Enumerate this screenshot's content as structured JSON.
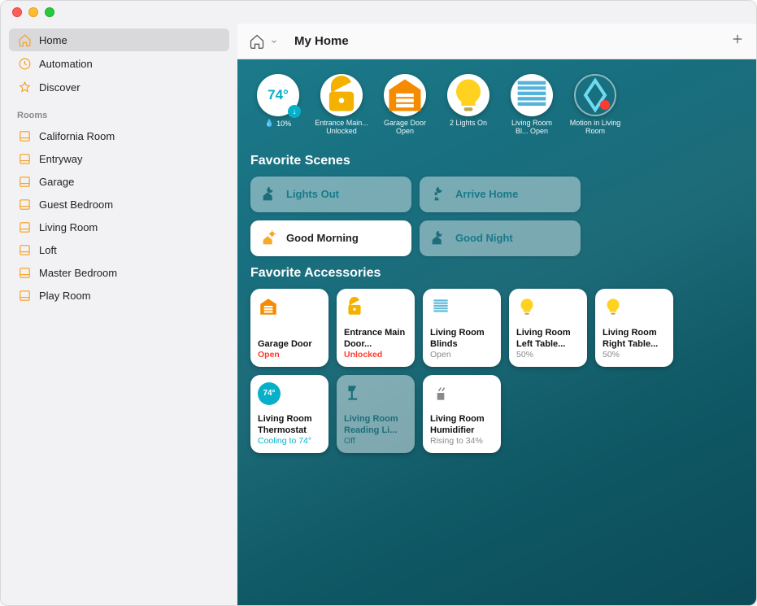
{
  "header": {
    "title": "My Home"
  },
  "sidebar": {
    "primary": [
      {
        "label": "Home",
        "icon": "home"
      },
      {
        "label": "Automation",
        "icon": "clock"
      },
      {
        "label": "Discover",
        "icon": "star"
      }
    ],
    "rooms_heading": "Rooms",
    "rooms": [
      {
        "label": "California Room"
      },
      {
        "label": "Entryway"
      },
      {
        "label": "Garage"
      },
      {
        "label": "Guest Bedroom"
      },
      {
        "label": "Living Room"
      },
      {
        "label": "Loft"
      },
      {
        "label": "Master Bedroom"
      },
      {
        "label": "Play Room"
      }
    ]
  },
  "status": {
    "temp": {
      "value": "74°",
      "precip": "10%"
    },
    "chips": [
      {
        "label": "Entrance Main... Unlocked",
        "icon": "lock-open",
        "color": "#f5b100"
      },
      {
        "label": "Garage Door Open",
        "icon": "garage",
        "color": "#f58b00"
      },
      {
        "label": "2 Lights On",
        "icon": "bulb",
        "color": "#ffd21f"
      },
      {
        "label": "Living Room Bl... Open",
        "icon": "blinds",
        "color": "#55b3d9"
      },
      {
        "label": "Motion in Living Room",
        "icon": "motion",
        "hollow": true,
        "color": "#6fdaf0"
      }
    ]
  },
  "scenes_heading": "Favorite Scenes",
  "scenes": [
    {
      "label": "Lights Out",
      "icon": "moon-house",
      "active": false
    },
    {
      "label": "Arrive Home",
      "icon": "moon-person",
      "active": false
    },
    {
      "label": "Good Morning",
      "icon": "sun-house",
      "active": true
    },
    {
      "label": "Good Night",
      "icon": "moon-house",
      "active": false
    }
  ],
  "accessories_heading": "Favorite Accessories",
  "accessories": [
    {
      "name": "Garage Door",
      "status": "Open",
      "statusClass": "red",
      "icon": "garage",
      "iconColor": "#f58b00"
    },
    {
      "name": "Entrance Main Door...",
      "status": "Unlocked",
      "statusClass": "red",
      "icon": "lock-open",
      "iconColor": "#f5b100"
    },
    {
      "name": "Living Room Blinds",
      "status": "Open",
      "statusClass": "",
      "icon": "blinds",
      "iconColor": "#5fb9da"
    },
    {
      "name": "Living Room Left Table...",
      "status": "50%",
      "statusClass": "",
      "icon": "bulb",
      "iconColor": "#ffd21f"
    },
    {
      "name": "Living Room Right Table...",
      "status": "50%",
      "statusClass": "",
      "icon": "bulb",
      "iconColor": "#ffd21f"
    },
    {
      "name": "Living Room Thermostat",
      "status": "Cooling to 74°",
      "statusClass": "blue",
      "icon": "thermo",
      "iconColor": "#06b0c8",
      "badge": "74°"
    },
    {
      "name": "Living Room Reading Li...",
      "status": "Off",
      "statusClass": "",
      "icon": "lamp",
      "off": true,
      "iconColor": "#1d6d7a"
    },
    {
      "name": "Living Room Humidifier",
      "status": "Rising to 34%",
      "statusClass": "",
      "icon": "humidifier",
      "iconColor": "#8a8a8e"
    }
  ]
}
